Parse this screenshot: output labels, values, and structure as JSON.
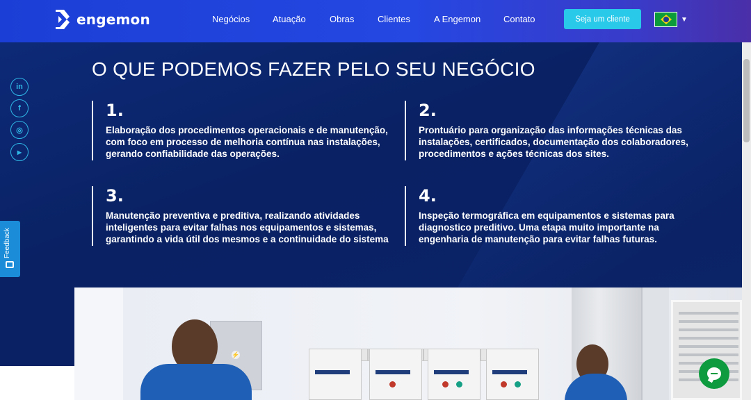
{
  "header": {
    "logo_text": "engemon",
    "nav": [
      {
        "label": "Negócios"
      },
      {
        "label": "Atuação"
      },
      {
        "label": "Obras"
      },
      {
        "label": "Clientes"
      },
      {
        "label": "A Engemon"
      },
      {
        "label": "Contato"
      }
    ],
    "cta_label": "Seja um cliente",
    "language_flag": "brazil-flag-icon"
  },
  "section": {
    "title": "O QUE PODEMOS FAZER PELO SEU NEGÓCIO",
    "cards": [
      {
        "number": "1.",
        "text": "Elaboração dos procedimentos operacionais e de manutenção, com foco em processo de melhoria contínua nas instalações, gerando confiabilidade das operações."
      },
      {
        "number": "2.",
        "text": "Prontuário para organização das informações técnicas das instalações, certificados, documentação dos colaboradores, procedimentos e ações técnicas dos sites."
      },
      {
        "number": "3.",
        "text": "Manutenção preventiva e preditiva, realizando atividades inteligentes para evitar falhas nos equipamentos e sistemas, garantindo a vida útil dos mesmos e a continuidade do sistema"
      },
      {
        "number": "4.",
        "text": "Inspeção termográfica em equipamentos e sistemas para diagnostico preditivo. Uma etapa muito importante na engenharia de manutenção para evitar falhas futuras."
      }
    ]
  },
  "social": [
    {
      "icon": "linkedin-icon",
      "glyph": "in"
    },
    {
      "icon": "facebook-icon",
      "glyph": "f"
    },
    {
      "icon": "instagram-icon",
      "glyph": "◎"
    },
    {
      "icon": "youtube-icon",
      "glyph": "▶"
    }
  ],
  "feedback_label": "Feedback",
  "colors": {
    "header_start": "#1b3fd6",
    "header_end": "#4a2fa8",
    "hero_bg": "#0a2264",
    "accent_cyan": "#29c9ea",
    "social_blue": "#2fb8e6",
    "feedback_blue": "#1a8cd8",
    "chat_green": "#0e9a3f"
  }
}
